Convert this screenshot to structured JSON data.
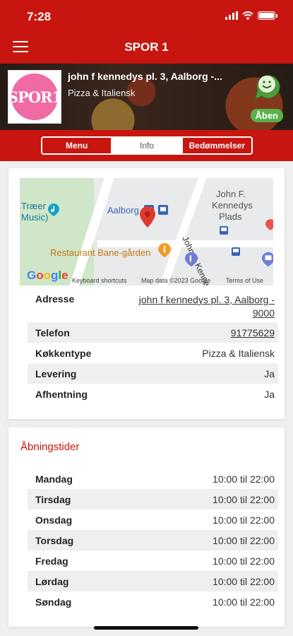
{
  "status_bar": {
    "time": "7:28"
  },
  "header": {
    "title": "SPOR 1"
  },
  "restaurant": {
    "logo_text": "SPOR1",
    "name": "john f kennedys pl. 3, Aalborg -...",
    "category": "Pizza & Italiensk",
    "status": "Åben"
  },
  "tabs": [
    {
      "label": "Menu"
    },
    {
      "label": "Info"
    },
    {
      "label": "Bedømmelser"
    }
  ],
  "map": {
    "labels": {
      "traeer": "Træer",
      "music": "Music)",
      "aalborg": "Aalborg",
      "jfk1": "John F.",
      "jfk2": "Kennedys",
      "jfk3": "Plads",
      "road": "John F. Kennedys",
      "restaurant": "Restaurant Bane-gården"
    },
    "google": "Google",
    "shortcuts": "Keyboard shortcuts",
    "map_data": "Map data ©2023 Google",
    "terms": "Terms of Use"
  },
  "info": [
    {
      "key": "Adresse",
      "value": "john f kennedys pl. 3, Aalborg - 9000"
    },
    {
      "key": "Telefon",
      "value": "91775629"
    },
    {
      "key": "Køkkentype",
      "value": "Pizza & Italiensk"
    },
    {
      "key": "Levering",
      "value": "Ja"
    },
    {
      "key": "Afhentning",
      "value": "Ja"
    }
  ],
  "hours_title": "Åbningstider",
  "hours": [
    {
      "day": "Mandag",
      "time": "10:00 til 22:00"
    },
    {
      "day": "Tirsdag",
      "time": "10:00 til 22:00"
    },
    {
      "day": "Onsdag",
      "time": "10:00 til 22:00"
    },
    {
      "day": "Torsdag",
      "time": "10:00 til 22:00"
    },
    {
      "day": "Fredag",
      "time": "10:00 til 22:00"
    },
    {
      "day": "Lørdag",
      "time": "10:00 til 22:00"
    },
    {
      "day": "Søndag",
      "time": "10:00 til 22:00"
    }
  ],
  "colors": {
    "brand": "#c8150f",
    "open": "#58b24a",
    "logo": "#f06aa5"
  }
}
